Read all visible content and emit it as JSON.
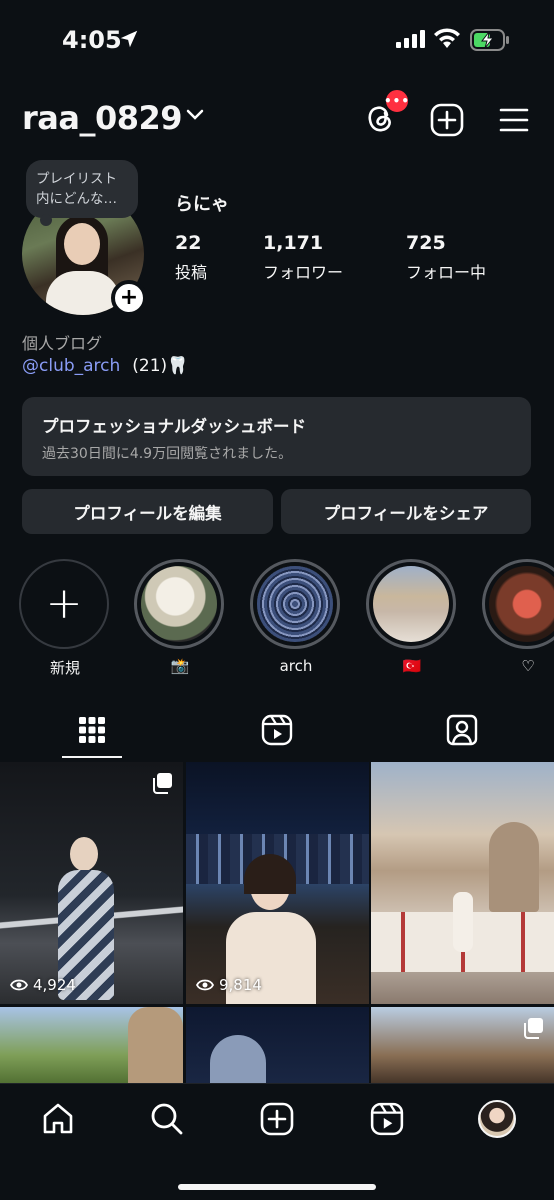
{
  "status_bar": {
    "time": "4:05"
  },
  "header": {
    "username": "raa_0829",
    "threads_badge": "•••"
  },
  "profile": {
    "note": "プレイリスト内にどんな…",
    "display_name": "らにゃ",
    "stats": [
      {
        "num": "22",
        "label": "投稿"
      },
      {
        "num": "1,171",
        "label": "フォロワー"
      },
      {
        "num": "725",
        "label": "フォロー中"
      }
    ],
    "category": "個人ブログ",
    "mention": "@club_arch",
    "bio_extra": "(21)🦷"
  },
  "dashboard": {
    "title": "プロフェッショナルダッシュボード",
    "subtitle": "過去30日間に4.9万回閲覧されました。"
  },
  "buttons": {
    "edit": "プロフィールを編集",
    "share": "プロフィールをシェア"
  },
  "highlights": [
    {
      "label": "新規"
    },
    {
      "label": "📸"
    },
    {
      "label": "arch"
    },
    {
      "label": "🇹🇷"
    },
    {
      "label": "♡"
    }
  ],
  "posts": [
    {
      "views": "4,924"
    },
    {
      "views": "9,814"
    }
  ],
  "colors": {
    "background": "#0c1014",
    "surface": "#262a2f",
    "badge": "#ff3040",
    "mention": "#8a9cf5"
  }
}
